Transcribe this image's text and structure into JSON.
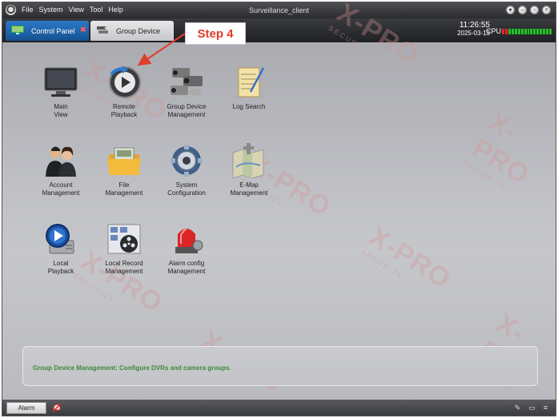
{
  "window": {
    "title": "Surveillance_client"
  },
  "menu": {
    "items": [
      "File",
      "System",
      "View",
      "Tool",
      "Help"
    ]
  },
  "tabs": [
    {
      "label": "Control Panel",
      "active": true,
      "icon": "monitor-icon"
    },
    {
      "label": "Group Device",
      "active": false,
      "icon": "device-group-icon"
    }
  ],
  "clock": {
    "time": "11:26:55",
    "date": "2025-03-13"
  },
  "cpu": {
    "label": "CPU"
  },
  "callout": {
    "label": "Step 4"
  },
  "watermark": {
    "text": "X-PRO",
    "subtext": "SECURITY"
  },
  "modules": [
    {
      "label": "Main\nView",
      "icon": "monitor-icon"
    },
    {
      "label": "Remote\nPlayback",
      "icon": "remote-playback-icon"
    },
    {
      "label": "Group Device\nManagement",
      "icon": "cameras-icon"
    },
    {
      "label": "Log Search",
      "icon": "log-notepad-icon"
    },
    {
      "label": "Account\nManagement",
      "icon": "users-icon"
    },
    {
      "label": "File\nManagement",
      "icon": "folder-icon"
    },
    {
      "label": "System\nConfiguration",
      "icon": "gear-icon"
    },
    {
      "label": "E-Map\nManagement",
      "icon": "map-icon"
    },
    {
      "label": "Local\nPlayback",
      "icon": "local-playback-icon"
    },
    {
      "label": "Local Record\nManagement",
      "icon": "film-reel-icon"
    },
    {
      "label": "Alarm config\nManagement",
      "icon": "siren-icon"
    }
  ],
  "status": {
    "message": "Group Device Management: Configure DVRs and camera groups."
  },
  "bottom": {
    "alarm_label": "Alarm"
  },
  "colors": {
    "accent_tab": "#1f66b2",
    "status_green": "#3c8a3c",
    "callout_red": "#e23d2a"
  }
}
